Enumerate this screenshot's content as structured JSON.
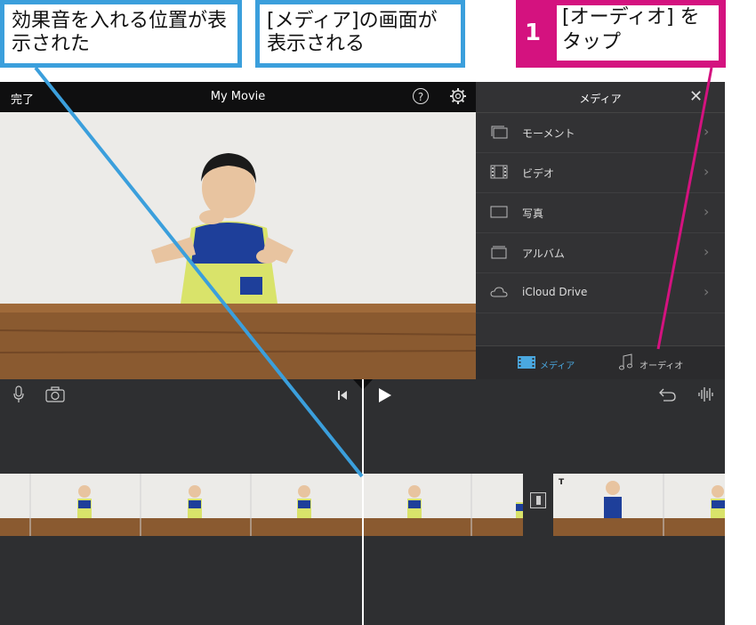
{
  "callouts": {
    "sfx_position": "効果音を入れる位置が表示された",
    "media_screen": "[メディア]の画面が表示される",
    "step_number": "1",
    "step_text": "[オーディオ] をタップ"
  },
  "app": {
    "done_label": "完了",
    "title": "My Movie",
    "help_label": "?"
  },
  "media_panel": {
    "title": "メディア",
    "close_label": "✕",
    "items": [
      {
        "label": "モーメント",
        "icon": "moments-icon"
      },
      {
        "label": "ビデオ",
        "icon": "film-icon"
      },
      {
        "label": "写真",
        "icon": "photo-icon"
      },
      {
        "label": "アルバム",
        "icon": "album-icon"
      },
      {
        "label": "iCloud Drive",
        "icon": "cloud-icon"
      }
    ],
    "tabs": {
      "media": "メディア",
      "audio": "オーディオ"
    }
  },
  "colors": {
    "accent_blue": "#3b9fdc",
    "step_magenta": "#d4127f",
    "panel_bg": "#323234",
    "topbar_bg": "#0f0f10",
    "timeline_bg": "#2e2f31",
    "active_tab": "#4aa8e0"
  }
}
